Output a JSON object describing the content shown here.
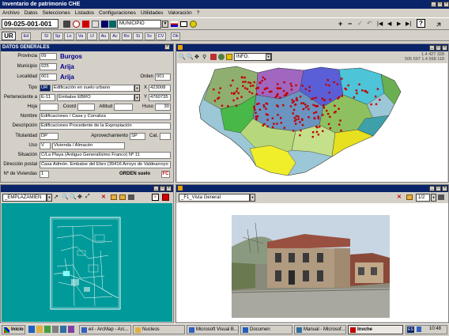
{
  "window": {
    "title": "Inventario de patrimonio CHE"
  },
  "menu": [
    "Archivo",
    "Datos",
    "Selecciones",
    "Listados",
    "Configuraciones",
    "Utilidades",
    "Valoración",
    "?"
  ],
  "toolbar": {
    "record_code": "09-025-001-001",
    "municipio_combo": "MUNICIPIO"
  },
  "toolbar2": {
    "ur_value": "UR",
    "edit_label": "Ed",
    "tabs": [
      "Sl",
      "Sp",
      "Lo",
      "Va",
      "Lf",
      "Au",
      "Ac",
      "Ro",
      "Si",
      "Sc",
      "CV"
    ],
    "ob_label": "Ob"
  },
  "form": {
    "header": "DATOS GENERALES",
    "provincia": {
      "label": "Provincia",
      "code": "09",
      "name": "Burgos"
    },
    "municipio": {
      "label": "Municipio",
      "code": "025",
      "name": "Arija"
    },
    "localidad": {
      "label": "Localidad",
      "code": "001",
      "name": "Arija"
    },
    "orden": {
      "label": "Orden",
      "value": "001"
    },
    "tipo": {
      "label": "Tipo",
      "code": "UR",
      "value": "Edificación en suelo urbano"
    },
    "x": {
      "label": "X",
      "value": "423008"
    },
    "pertenece": {
      "label": "Perteneciente a",
      "code": "E-11",
      "value": "Embalse EBRO"
    },
    "y": {
      "label": "Y",
      "value": "4760735"
    },
    "hoja": {
      "label": "Hoja",
      "value": ""
    },
    "coord": {
      "label": "Coord",
      "value": ""
    },
    "altitud": {
      "label": "Altitud",
      "value": ""
    },
    "huso": {
      "label": "Huso",
      "value": "30"
    },
    "nombre": {
      "label": "Nombre",
      "value": "Edificaciones / Casa y Corraliza"
    },
    "descripcion": {
      "label": "Descripción",
      "value": "Edificaciones Procedente de la Expropiación"
    },
    "titularidad": {
      "label": "Titularidad",
      "value": "DP"
    },
    "aprovechamiento": {
      "label": "Aprovechamiento",
      "value": "SP"
    },
    "cat": {
      "label": "Cat.",
      "value": ""
    },
    "uso": {
      "label": "Uso",
      "code": "V",
      "value": "Vivienda / Almacén"
    },
    "situacion": {
      "label": "Situación",
      "value": "C/La Playa (Antiguo Generalísimo Franco) Nº 11"
    },
    "direccion": {
      "label": "Dirección postal",
      "value": "Casa Admón. Embalse del Ebro (39416 Arroyo de Valdearroyo"
    },
    "viviendas": {
      "label": "Nº de Viviendas",
      "value": "1"
    },
    "orden_suelo": {
      "label": "ORDEN suelo",
      "value": ""
    }
  },
  "map_panel": {
    "combo": "INFO.",
    "coords_line1": "1.4 427 328",
    "coords_line2": "505 597 1.4 568 118"
  },
  "plan_panel": {
    "combo": "_EMPLAZAMIEN"
  },
  "photo_panel": {
    "combo": "_F1_Vista General",
    "page": "1/2"
  },
  "taskbar": {
    "start": "Inicio",
    "tasks": [
      "eil - ArcMap - Arc...",
      "Nucleos",
      "Microsoft Visual B...",
      "Documen",
      "Manual - Microsof...",
      "Invche"
    ],
    "lang": "ES",
    "clock": "10:48"
  },
  "colors": {
    "titlebar": "#0a246a",
    "map_bg": "#ffffff",
    "panel_teal": "#009a9a"
  }
}
